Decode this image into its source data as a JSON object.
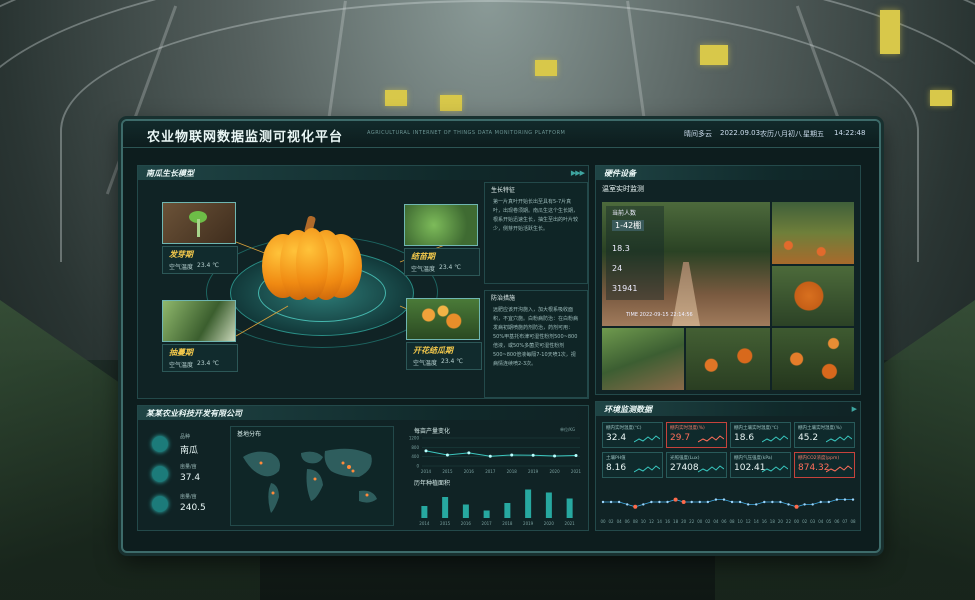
{
  "header": {
    "title": "农业物联网数据监测可视化平台",
    "subtitle": "AGRICULTURAL INTERNET OF THINGS DATA MONITORING PLATFORM",
    "weather": "晴间多云",
    "date": "2022.09.03",
    "lunar": "农历八月初八",
    "weekday": "星期五",
    "time": "14:22:48"
  },
  "growth": {
    "title": "南瓜生长模型",
    "stages": [
      {
        "name": "发芽期",
        "temp_label": "空气温度",
        "temp": "23.4 ℃"
      },
      {
        "name": "结苗期",
        "temp_label": "空气温度",
        "temp": "23.4 ℃"
      },
      {
        "name": "抽蔓期",
        "temp_label": "空气温度",
        "temp": "23.4 ℃"
      },
      {
        "name": "开花结瓜期",
        "temp_label": "空气温度",
        "temp": "23.4 ℃"
      }
    ],
    "features_title": "生长特征",
    "features_text": "第一片真叶开始长出至具有5-7片真叶，出现卷须期。南瓜生这个生长期，根系开始迅速生长，抽生至出的叶片较少，侧芽开始活跃生长。",
    "prevention_title": "防治措施",
    "prevention_text": "远肥应该开沟施入，加大根系吸收面积，不宜穴施。白粉病防治：在白粉病发病初期喷施药剂防治，药剂可用：50%甲基托布津可湿性粉剂500~800倍液，或50%多菌灵可湿性粉剂500~800倍液每隔7-10天喷1次，视病情连续喷2-3次。"
  },
  "company": {
    "title": "某某农业科技开发有限公司",
    "stats": [
      {
        "label": "品种",
        "value": "南瓜"
      },
      {
        "label": "亩量/亩",
        "value": "37.4"
      },
      {
        "label": "亩量/亩",
        "value": "240.5"
      }
    ],
    "map_title": "基地分布",
    "line_title": "每亩产量变化",
    "line_unit": "单位/KG",
    "bar_title": "历年种植面积"
  },
  "chart_data": [
    {
      "type": "line",
      "title": "每亩产量变化",
      "ylabel": "单位/KG",
      "x": [
        "2014",
        "2015",
        "2016",
        "2017",
        "2018",
        "2019",
        "2020",
        "2021"
      ],
      "ylim": [
        0,
        1200
      ],
      "y_ticks": [
        "0",
        "400",
        "800",
        "1200"
      ],
      "series": [
        {
          "values": [
            650,
            470,
            560,
            420,
            470,
            460,
            430,
            450
          ]
        }
      ],
      "grid": true
    },
    {
      "type": "bar",
      "title": "历年种植面积",
      "categories": [
        "2014",
        "2015",
        "2016",
        "2017",
        "2018",
        "2019",
        "2020",
        "2021"
      ],
      "values": [
        40,
        70,
        45,
        25,
        50,
        95,
        85,
        65
      ],
      "ylim": [
        0,
        100
      ]
    },
    {
      "type": "line",
      "title": "环境监测数据",
      "x": [
        "00",
        "02",
        "04",
        "06",
        "08",
        "10",
        "12",
        "14",
        "16",
        "18",
        "20",
        "22",
        "00",
        "02",
        "04",
        "06",
        "08",
        "10",
        "12",
        "14",
        "16",
        "18",
        "20",
        "22",
        "00",
        "02",
        "03",
        "04",
        "05",
        "06",
        "07",
        "08"
      ],
      "ylim": [
        0,
        10
      ],
      "series": [
        {
          "values": [
            5,
            5,
            5,
            4,
            3,
            4,
            5,
            5,
            5,
            6,
            5,
            5,
            5,
            5,
            6,
            6,
            5,
            5,
            4,
            4,
            5,
            5,
            5,
            4,
            3,
            4,
            4,
            5,
            5,
            6,
            6,
            6
          ]
        }
      ]
    }
  ],
  "hardware": {
    "title": "硬件设备",
    "camera_title": "温室实时监测",
    "overlay": {
      "people_label": "当前人数",
      "greenhouse": "1-42棚",
      "values": [
        "18.3",
        "24",
        "31941"
      ],
      "timestamp": "TIME 2022-09-15 22:14:56"
    },
    "env_title": "环境监测数据",
    "env_cards": [
      {
        "label": "棚内实时温度(℃)",
        "value": "32.4",
        "alert": false
      },
      {
        "label": "棚内实时湿度(%)",
        "value": "29.7",
        "alert": true
      },
      {
        "label": "棚内土壤实时温度(℃)",
        "value": "18.6",
        "alert": false
      },
      {
        "label": "棚内土壤实时湿度(%)",
        "value": "45.2",
        "alert": false
      },
      {
        "label": "土壤PH值",
        "value": "8.16",
        "alert": false
      },
      {
        "label": "光照强度(Lux)",
        "value": "27408",
        "alert": false
      },
      {
        "label": "棚内气压强度(kPa)",
        "value": "102.41",
        "alert": false
      },
      {
        "label": "棚内CO2浓度(ppm)",
        "value": "874.32",
        "alert": true
      }
    ]
  },
  "colors": {
    "accent": "#2fc2bd",
    "alert": "#ff5a4a",
    "highlight": "#f2c84b",
    "panel": "#0d1d1e"
  }
}
